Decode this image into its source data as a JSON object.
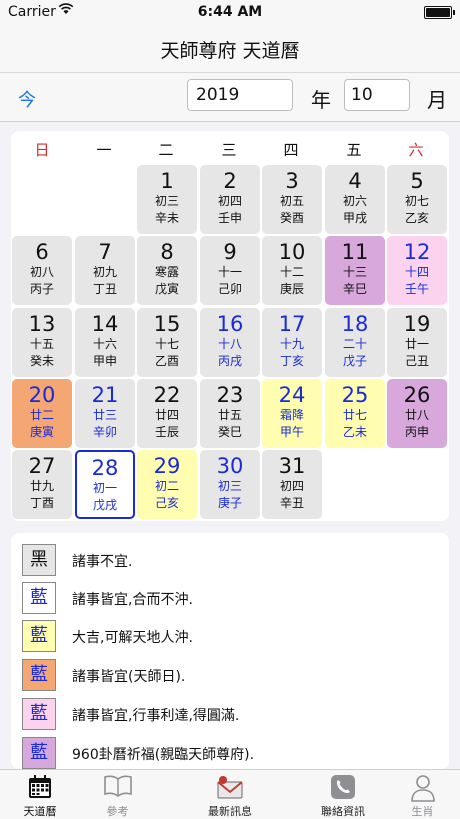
{
  "status": {
    "carrier": "Carrier",
    "time": "6:44 AM"
  },
  "nav": {
    "title": "天師尊府 天道曆"
  },
  "datebar": {
    "today_label": "今",
    "year": "2019",
    "year_label": "年",
    "month": "10",
    "month_label": "月"
  },
  "weekdays": [
    "日",
    "一",
    "二",
    "三",
    "四",
    "五",
    "六"
  ],
  "days": [
    {
      "d": "1",
      "l": "初三",
      "g": "辛未"
    },
    {
      "d": "2",
      "l": "初四",
      "g": "壬申"
    },
    {
      "d": "3",
      "l": "初五",
      "g": "癸酉"
    },
    {
      "d": "4",
      "l": "初六",
      "g": "甲戌"
    },
    {
      "d": "5",
      "l": "初七",
      "g": "乙亥"
    },
    {
      "d": "6",
      "l": "初八",
      "g": "丙子"
    },
    {
      "d": "7",
      "l": "初九",
      "g": "丁丑"
    },
    {
      "d": "8",
      "l": "寒露",
      "g": "戊寅"
    },
    {
      "d": "9",
      "l": "十一",
      "g": "己卯"
    },
    {
      "d": "10",
      "l": "十二",
      "g": "庚辰"
    },
    {
      "d": "11",
      "l": "十三",
      "g": "辛巳"
    },
    {
      "d": "12",
      "l": "十四",
      "g": "壬午"
    },
    {
      "d": "13",
      "l": "十五",
      "g": "癸未"
    },
    {
      "d": "14",
      "l": "十六",
      "g": "甲申"
    },
    {
      "d": "15",
      "l": "十七",
      "g": "乙酉"
    },
    {
      "d": "16",
      "l": "十八",
      "g": "丙戌"
    },
    {
      "d": "17",
      "l": "十九",
      "g": "丁亥"
    },
    {
      "d": "18",
      "l": "二十",
      "g": "戊子"
    },
    {
      "d": "19",
      "l": "廿一",
      "g": "己丑"
    },
    {
      "d": "20",
      "l": "廿二",
      "g": "庚寅"
    },
    {
      "d": "21",
      "l": "廿三",
      "g": "辛卯"
    },
    {
      "d": "22",
      "l": "廿四",
      "g": "壬辰"
    },
    {
      "d": "23",
      "l": "廿五",
      "g": "癸巳"
    },
    {
      "d": "24",
      "l": "霜降",
      "g": "甲午"
    },
    {
      "d": "25",
      "l": "廿七",
      "g": "乙未"
    },
    {
      "d": "26",
      "l": "廿八",
      "g": "丙申"
    },
    {
      "d": "27",
      "l": "廿九",
      "g": "丁酉"
    },
    {
      "d": "28",
      "l": "初一",
      "g": "戊戌"
    },
    {
      "d": "29",
      "l": "初二",
      "g": "己亥"
    },
    {
      "d": "30",
      "l": "初三",
      "g": "庚子"
    },
    {
      "d": "31",
      "l": "初四",
      "g": "辛丑"
    }
  ],
  "legend": [
    {
      "mark": "黑",
      "text": "諸事不宜."
    },
    {
      "mark": "藍",
      "text": "諸事皆宜,合而不沖."
    },
    {
      "mark": "藍",
      "text": "大吉,可解天地人沖."
    },
    {
      "mark": "藍",
      "text": "諸事皆宜(天師日)."
    },
    {
      "mark": "藍",
      "text": "諸事皆宜,行事利達,得圓滿."
    },
    {
      "mark": "藍",
      "text": "960卦曆祈福(親臨天師尊府)."
    }
  ],
  "tabs": [
    {
      "label": "天道曆",
      "icon": "calendar-icon"
    },
    {
      "label": "參考",
      "icon": "book-icon"
    },
    {
      "label": "最新訊息",
      "icon": "mail-icon"
    },
    {
      "label": "聯絡資訊",
      "icon": "phone-icon"
    },
    {
      "label": "生肖",
      "icon": "person-icon"
    }
  ],
  "colors": {
    "accent_blue": "#1a2bd6",
    "link_blue": "#1a73e8",
    "weekend_red": "#d32f2f",
    "cell_gray": "#e6e6e6",
    "yellow": "#fffdb0",
    "orange": "#f4a673",
    "pink": "#fbd3ef",
    "purple": "#d8a8dc"
  }
}
